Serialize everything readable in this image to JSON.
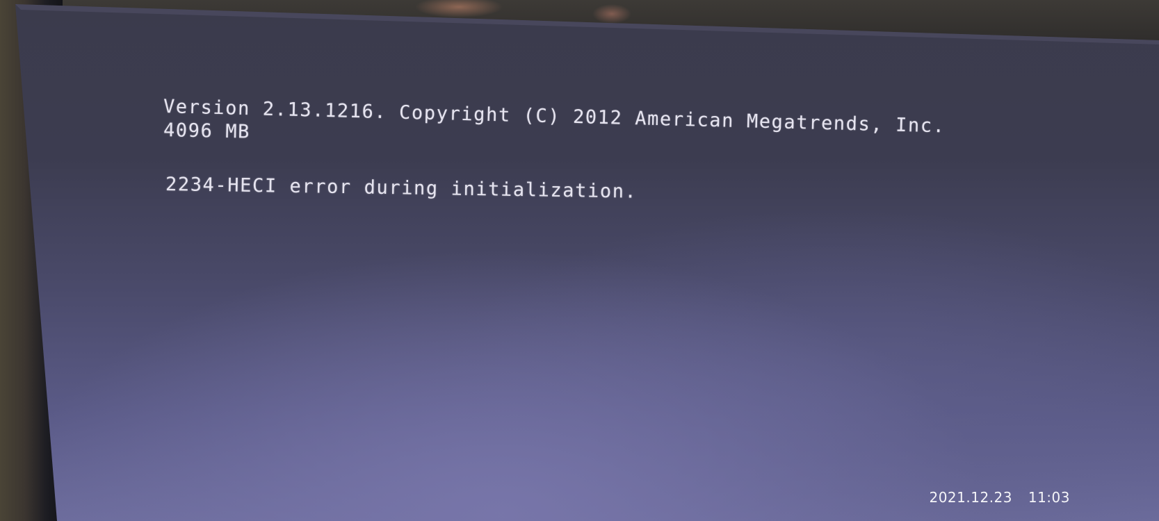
{
  "bios_screen": {
    "lines": {
      "version": "Version 2.13.1216. Copyright (C) 2012 American Megatrends, Inc.",
      "memory": "4096 MB",
      "error": "2234-HECI error during initialization."
    },
    "colors": {
      "text": "#e6e4f0",
      "screen_background": "#4a4a6a"
    }
  },
  "photo_overlay": {
    "date": "2021.12.23",
    "time": "11:03"
  }
}
